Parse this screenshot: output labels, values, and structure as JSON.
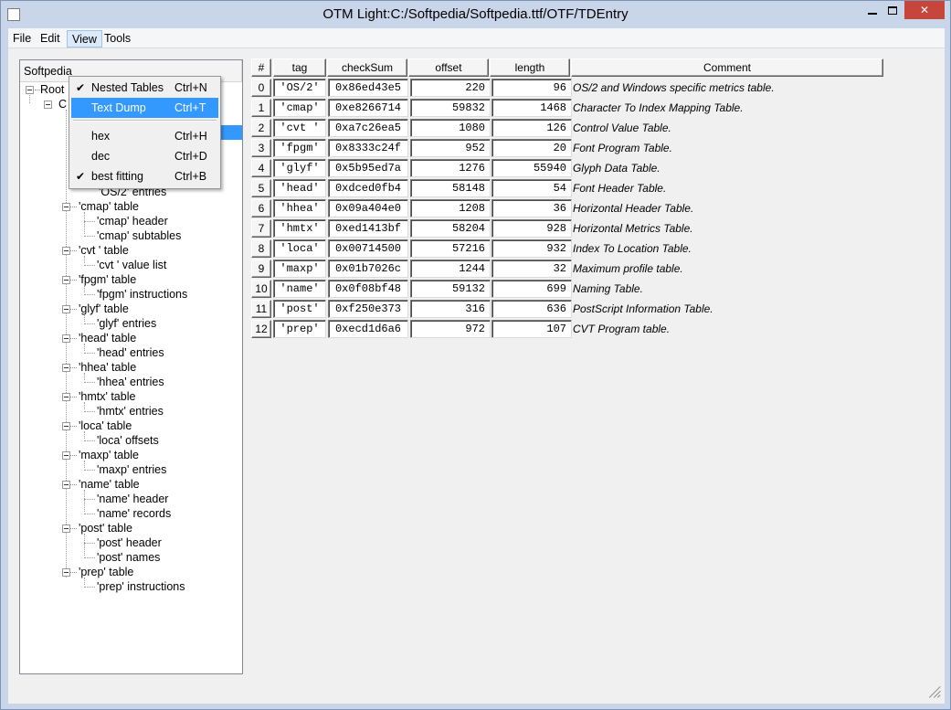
{
  "window": {
    "title": "OTM Light:C:/Softpedia/Softpedia.ttf/OTF/TDEntry",
    "minimize_label": "",
    "close_label": "✕"
  },
  "menubar": {
    "items": [
      "File",
      "Edit",
      "View",
      "Tools"
    ]
  },
  "view_menu": {
    "items": [
      {
        "label": "Nested Tables",
        "shortcut": "Ctrl+N",
        "checked": "✔"
      },
      {
        "label": "Text Dump",
        "shortcut": "Ctrl+T",
        "checked": ""
      },
      {
        "label": "hex",
        "shortcut": "Ctrl+H",
        "checked": ""
      },
      {
        "label": "dec",
        "shortcut": "Ctrl+D",
        "checked": ""
      },
      {
        "label": "best fitting",
        "shortcut": "Ctrl+B",
        "checked": "✔"
      }
    ]
  },
  "tree": {
    "header": "Softpedia",
    "root": "Root",
    "font": "C",
    "os2_entries": "'OS/2' entries",
    "tables": [
      {
        "label": "'cmap' table",
        "children": [
          "'cmap' header",
          "'cmap' subtables"
        ]
      },
      {
        "label": "'cvt ' table",
        "children": [
          "'cvt ' value list"
        ]
      },
      {
        "label": "'fpgm' table",
        "children": [
          "'fpgm' instructions"
        ]
      },
      {
        "label": "'glyf' table",
        "children": [
          "'glyf' entries"
        ]
      },
      {
        "label": "'head' table",
        "children": [
          "'head' entries"
        ]
      },
      {
        "label": "'hhea' table",
        "children": [
          "'hhea' entries"
        ]
      },
      {
        "label": "'hmtx' table",
        "children": [
          "'hmtx' entries"
        ]
      },
      {
        "label": "'loca' table",
        "children": [
          "'loca' offsets"
        ]
      },
      {
        "label": "'maxp' table",
        "children": [
          "'maxp' entries"
        ]
      },
      {
        "label": "'name' table",
        "children": [
          "'name' header",
          "'name' records"
        ]
      },
      {
        "label": "'post' table",
        "children": [
          "'post' header",
          "'post' names"
        ]
      },
      {
        "label": "'prep' table",
        "children": [
          "'prep' instructions"
        ]
      }
    ]
  },
  "grid": {
    "columns": [
      "#",
      "tag",
      "checkSum",
      "offset",
      "length",
      "Comment"
    ],
    "rows": [
      {
        "num": "0",
        "tag": "'OS/2'",
        "checksum": "0x86ed43e5",
        "offset": "220",
        "length": "96",
        "comment": "OS/2 and Windows specific metrics table."
      },
      {
        "num": "1",
        "tag": "'cmap'",
        "checksum": "0xe8266714",
        "offset": "59832",
        "length": "1468",
        "comment": "Character To Index Mapping Table."
      },
      {
        "num": "2",
        "tag": "'cvt '",
        "checksum": "0xa7c26ea5",
        "offset": "1080",
        "length": "126",
        "comment": "Control Value Table."
      },
      {
        "num": "3",
        "tag": "'fpgm'",
        "checksum": "0x8333c24f",
        "offset": "952",
        "length": "20",
        "comment": "Font Program Table."
      },
      {
        "num": "4",
        "tag": "'glyf'",
        "checksum": "0x5b95ed7a",
        "offset": "1276",
        "length": "55940",
        "comment": "Glyph Data Table."
      },
      {
        "num": "5",
        "tag": "'head'",
        "checksum": "0xdced0fb4",
        "offset": "58148",
        "length": "54",
        "comment": "Font Header Table."
      },
      {
        "num": "6",
        "tag": "'hhea'",
        "checksum": "0x09a404e0",
        "offset": "1208",
        "length": "36",
        "comment": "Horizontal Header Table."
      },
      {
        "num": "7",
        "tag": "'hmtx'",
        "checksum": "0xed1413bf",
        "offset": "58204",
        "length": "928",
        "comment": "Horizontal Metrics Table."
      },
      {
        "num": "8",
        "tag": "'loca'",
        "checksum": "0x00714500",
        "offset": "57216",
        "length": "932",
        "comment": "Index To Location Table."
      },
      {
        "num": "9",
        "tag": "'maxp'",
        "checksum": "0x01b7026c",
        "offset": "1244",
        "length": "32",
        "comment": "Maximum profile table."
      },
      {
        "num": "10",
        "tag": "'name'",
        "checksum": "0x0f08bf48",
        "offset": "59132",
        "length": "699",
        "comment": "Naming Table."
      },
      {
        "num": "11",
        "tag": "'post'",
        "checksum": "0xf250e373",
        "offset": "316",
        "length": "636",
        "comment": "PostScript Information Table."
      },
      {
        "num": "12",
        "tag": "'prep'",
        "checksum": "0xecd1d6a6",
        "offset": "972",
        "length": "107",
        "comment": "CVT Program table."
      }
    ]
  }
}
